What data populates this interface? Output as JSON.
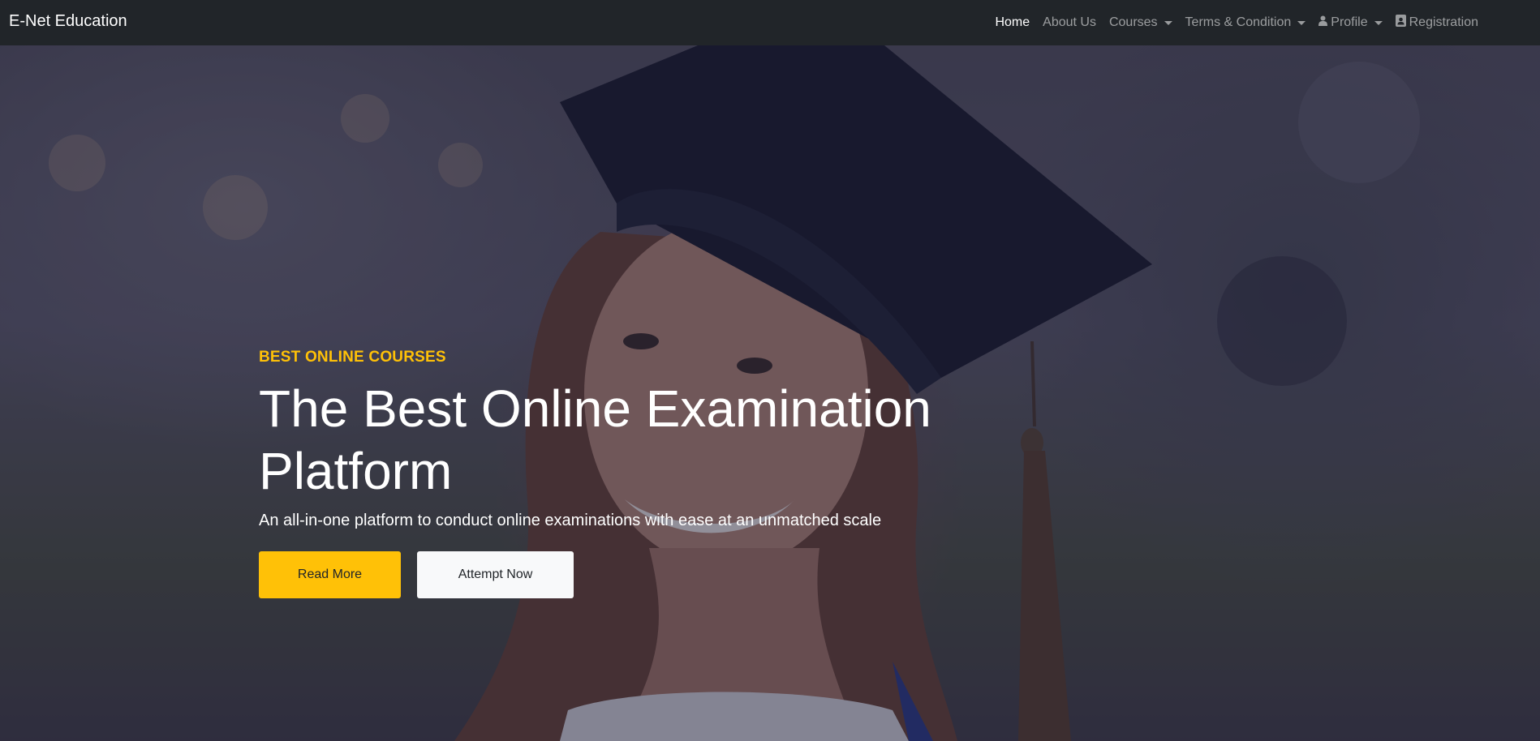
{
  "navbar": {
    "brand": "E-Net Education",
    "items": [
      {
        "label": "Home",
        "active": true,
        "dropdown": false,
        "icon": ""
      },
      {
        "label": "About Us",
        "active": false,
        "dropdown": false,
        "icon": ""
      },
      {
        "label": "Courses",
        "active": false,
        "dropdown": true,
        "icon": ""
      },
      {
        "label": "Terms & Condition",
        "active": false,
        "dropdown": true,
        "icon": ""
      },
      {
        "label": "Profile",
        "active": false,
        "dropdown": true,
        "icon": "user-icon"
      },
      {
        "label": "Registration",
        "active": false,
        "dropdown": false,
        "icon": "id-card-icon"
      }
    ]
  },
  "hero": {
    "kicker": "BEST ONLINE COURSES",
    "headline": "The Best Online Examination Platform",
    "subtitle": "An all-in-one platform to conduct online examinations with ease at an unmatched scale",
    "read_more_label": "Read More",
    "attempt_now_label": "Attempt Now"
  },
  "colors": {
    "navbar_bg": "#212529",
    "accent": "#ffc107",
    "light_button": "#f8f9fa"
  }
}
